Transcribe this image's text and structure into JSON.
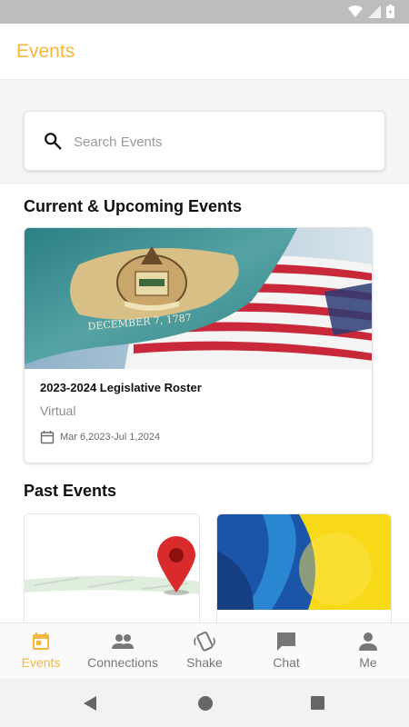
{
  "app": {
    "title": "Events"
  },
  "search": {
    "placeholder": "Search Events"
  },
  "sections": {
    "current_title": "Current & Upcoming Events",
    "past_title": "Past Events"
  },
  "current_events": [
    {
      "title": "2023-2024 Legislative Roster",
      "location": "Virtual",
      "date": "Mar  6,2023-Jul  1,2024",
      "banner_text": "DECEMBER 7, 1787"
    }
  ],
  "past_events": [
    {
      "image": "map-pin-image"
    },
    {
      "image": "blue-yellow-abstract-image"
    }
  ],
  "bottom_nav": [
    {
      "label": "Events",
      "icon": "calendar-icon",
      "active": true
    },
    {
      "label": "Connections",
      "icon": "people-icon",
      "active": false
    },
    {
      "label": "Shake",
      "icon": "shake-phone-icon",
      "active": false
    },
    {
      "label": "Chat",
      "icon": "chat-bubble-icon",
      "active": false
    },
    {
      "label": "Me",
      "icon": "person-icon",
      "active": false
    }
  ],
  "colors": {
    "accent": "#f6b73c",
    "inactive": "#777777"
  }
}
